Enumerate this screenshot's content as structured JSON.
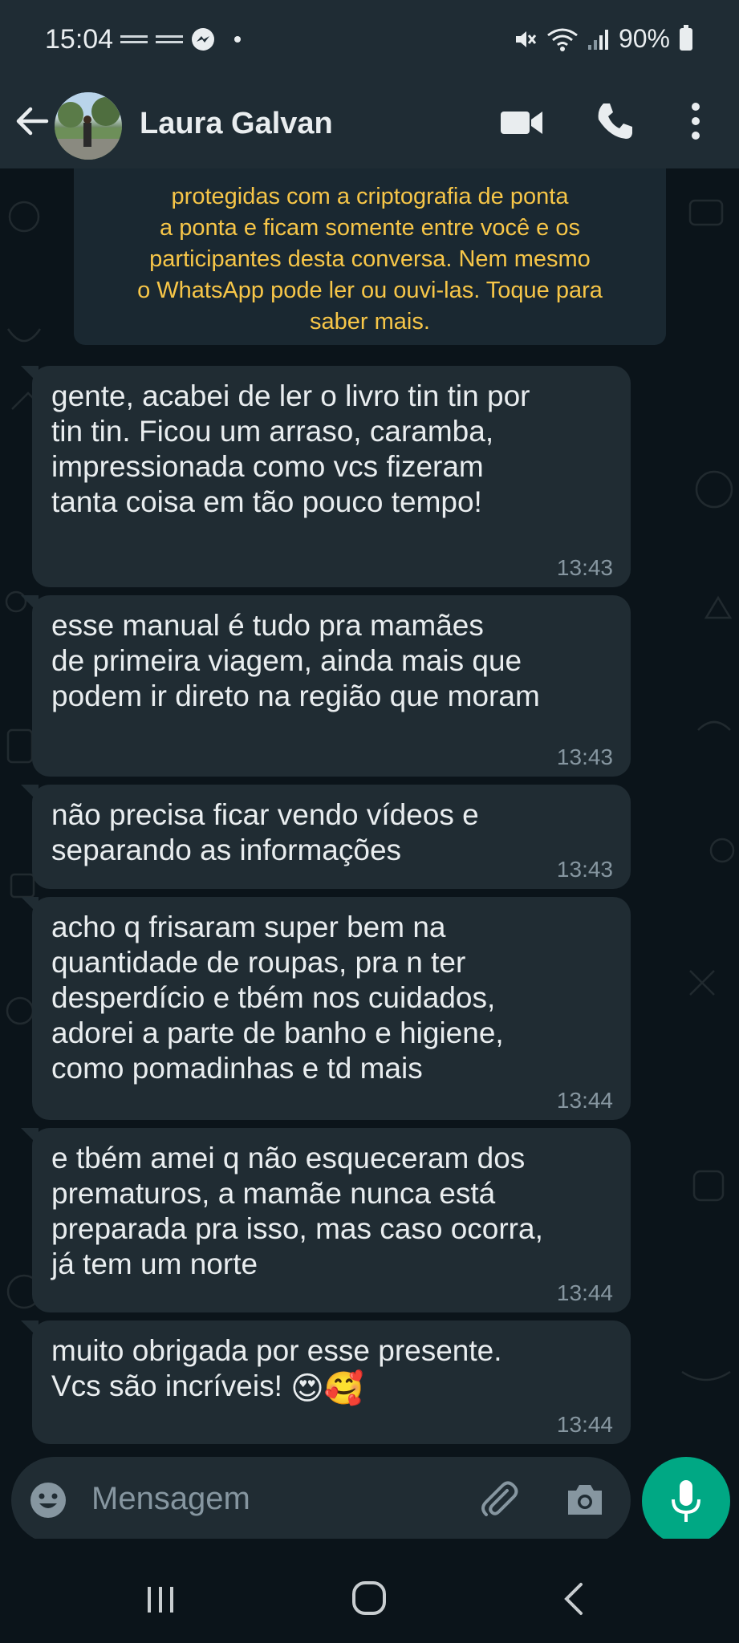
{
  "status_bar": {
    "time": "15:04",
    "battery": "90%",
    "icons": [
      "signal-dash-icon",
      "signal-dash-icon",
      "messenger-icon",
      "notification-dot",
      "mute-icon",
      "wifi-icon",
      "cell-signal-icon",
      "battery-icon"
    ]
  },
  "header": {
    "contact_name": "Laura Galvan",
    "icons": [
      "back-arrow-icon",
      "video-call-icon",
      "voice-call-icon",
      "more-options-icon"
    ]
  },
  "encryption_notice": {
    "lines": [
      "protegidas com a criptografia de ponta",
      "a ponta e ficam somente entre você e os",
      "participantes desta conversa. Nem mesmo",
      "o WhatsApp pode ler ou ouvi-las. Toque para",
      "saber mais."
    ]
  },
  "messages": [
    {
      "text": "gente, acabei de ler o livro tin tin por\ntin tin. Ficou um arraso, caramba,\nimpressionada como vcs fizeram\ntanta coisa em tão pouco tempo!",
      "time": "13:43"
    },
    {
      "text": "esse manual é tudo pra mamães\nde primeira viagem, ainda mais que\npodem ir direto na região que moram",
      "time": "13:43"
    },
    {
      "text": "não precisa ficar vendo vídeos e\nseparando as informações",
      "time": "13:43"
    },
    {
      "text": "acho q frisaram super bem na\nquantidade de roupas, pra n ter\ndesperdício e tbém nos cuidados,\nadorei a parte de banho e higiene,\ncomo pomadinhas e td mais",
      "time": "13:44"
    },
    {
      "text": "e tbém amei q não esqueceram dos\nprematuros, a mamãe nunca está\npreparada pra isso, mas caso ocorra,\njá tem um norte",
      "time": "13:44"
    },
    {
      "text": "muito obrigada por esse presente.\nVcs são incríveis! ",
      "emojis": "😍🥰",
      "time": "13:44"
    }
  ],
  "input": {
    "placeholder": "Mensagem",
    "icons": [
      "emoji-icon",
      "attach-icon",
      "camera-icon",
      "mic-icon"
    ]
  },
  "colors": {
    "background": "#0b141a",
    "header": "#1f2c34",
    "bubble": "#202c33",
    "notice_text": "#f7c648",
    "timestamp": "#8696a0",
    "accent": "#00a884"
  }
}
